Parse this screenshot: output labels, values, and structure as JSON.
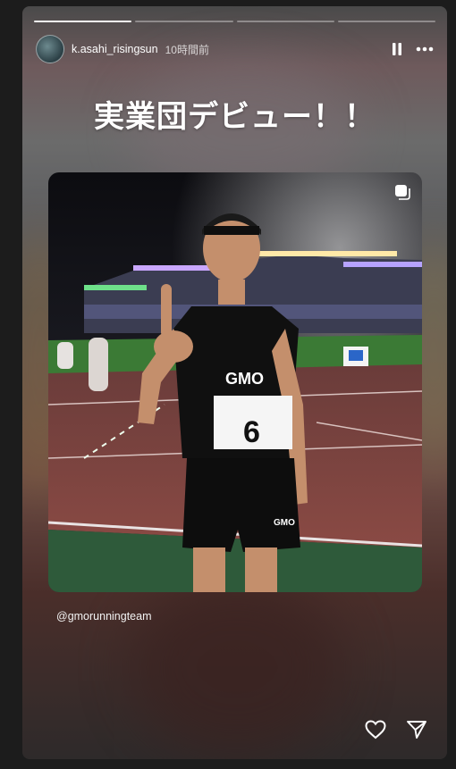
{
  "story": {
    "username": "k.asahi_risingsun",
    "time_ago": "10時間前",
    "headline": "実業団デビュー！！",
    "mention": "@gmorunningteam",
    "progress_segments": 4,
    "active_segment": 1
  },
  "photo": {
    "shirt_brand": "GMO",
    "bib_number": "6",
    "shorts_brand": "GMO"
  },
  "icons": {
    "pause": "pause-icon",
    "more": "more-icon",
    "multi": "multi-photo-icon",
    "like": "heart-icon",
    "share": "share-icon"
  }
}
